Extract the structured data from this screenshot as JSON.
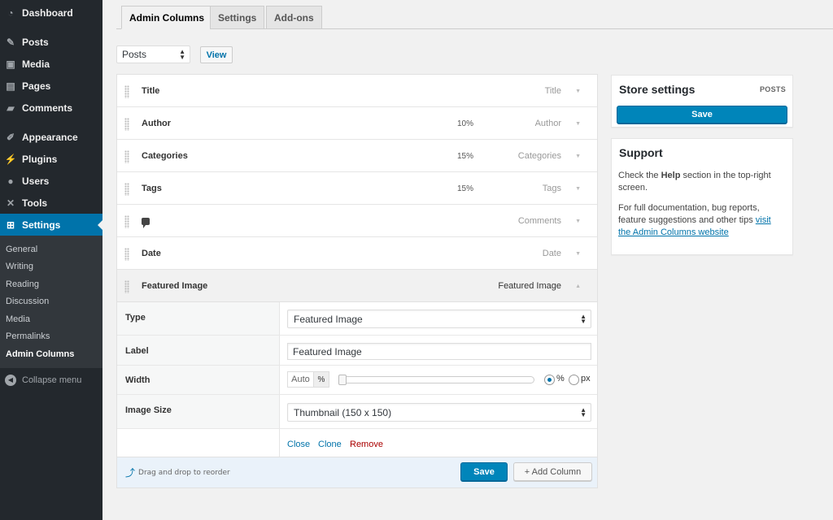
{
  "sidebar": {
    "top_items": [
      {
        "label": "Dashboard",
        "icon": "dashboard-icon"
      }
    ],
    "items": [
      {
        "label": "Posts",
        "icon": "pin-icon"
      },
      {
        "label": "Media",
        "icon": "media-icon"
      },
      {
        "label": "Pages",
        "icon": "pages-icon"
      },
      {
        "label": "Comments",
        "icon": "comment-icon"
      }
    ],
    "items2": [
      {
        "label": "Appearance",
        "icon": "brush-icon"
      },
      {
        "label": "Plugins",
        "icon": "plug-icon"
      },
      {
        "label": "Users",
        "icon": "user-icon"
      },
      {
        "label": "Tools",
        "icon": "wrench-icon"
      },
      {
        "label": "Settings",
        "icon": "settings-icon"
      }
    ],
    "submenu": [
      "General",
      "Writing",
      "Reading",
      "Discussion",
      "Media",
      "Permalinks",
      "Admin Columns"
    ],
    "collapse_label": "Collapse menu"
  },
  "tabs": [
    "Admin Columns",
    "Settings",
    "Add-ons"
  ],
  "post_type": {
    "selected": "Posts",
    "view_label": "View"
  },
  "columns": [
    {
      "label": "Title",
      "width": "",
      "type": "Title"
    },
    {
      "label": "Author",
      "width": "10%",
      "type": "Author"
    },
    {
      "label": "Categories",
      "width": "15%",
      "type": "Categories"
    },
    {
      "label": "Tags",
      "width": "15%",
      "type": "Tags"
    },
    {
      "label": "",
      "width": "",
      "type": "Comments",
      "icon": "comment-bubble-icon"
    },
    {
      "label": "Date",
      "width": "",
      "type": "Date"
    },
    {
      "label": "Featured Image",
      "width": "",
      "type": "Featured Image",
      "open": true
    }
  ],
  "settings": {
    "type_label": "Type",
    "type_value": "Featured Image",
    "label_label": "Label",
    "label_value": "Featured Image",
    "width_label": "Width",
    "width_auto": "Auto",
    "width_unit": "%",
    "unit_percent": "%",
    "unit_px": "px",
    "width_unit_selected": "%",
    "image_size_label": "Image Size",
    "image_size_value": "Thumbnail (150 x 150)",
    "actions": {
      "close": "Close",
      "clone": "Clone",
      "remove": "Remove"
    }
  },
  "footer": {
    "hint": "Drag and drop to reorder",
    "save_label": "Save",
    "add_column_label": "+ Add Column"
  },
  "store_box": {
    "title": "Store settings",
    "tag": "POSTS",
    "save_label": "Save"
  },
  "support_box": {
    "title": "Support",
    "p1_pre": "Check the ",
    "p1_bold": "Help",
    "p1_post": " section in the top-right screen.",
    "p2": "For full documentation, bug reports, feature suggestions and other tips ",
    "p2_link": "visit the Admin Columns website"
  },
  "colors": {
    "sidebar_bg": "#23282d",
    "accent": "#0073aa",
    "button_primary": "#0085ba"
  }
}
